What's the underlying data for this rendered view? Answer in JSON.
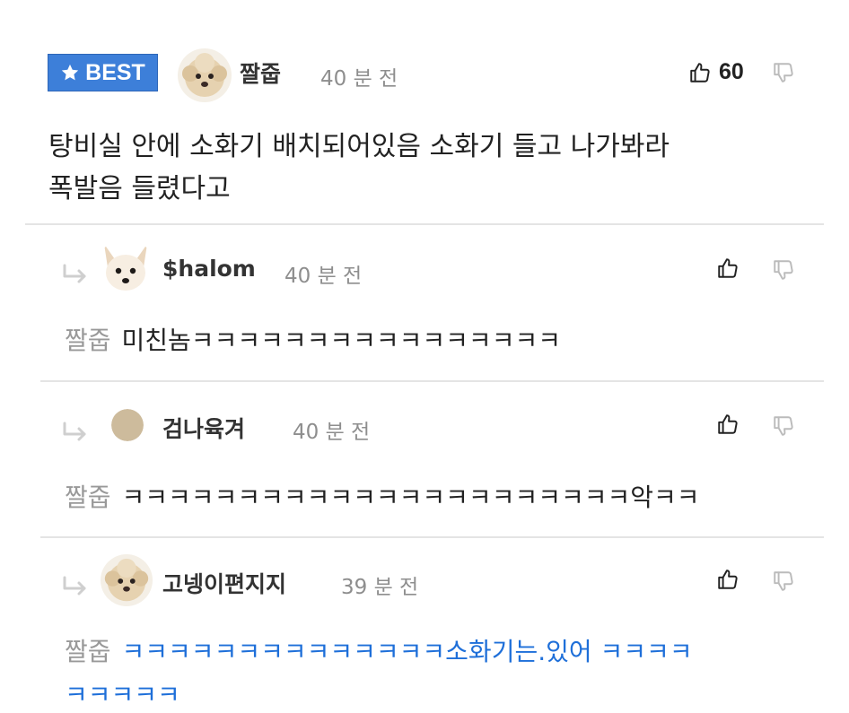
{
  "best": {
    "badge_label": "BEST",
    "author": "짤줍",
    "time": "40 분 전",
    "likes": "60",
    "text_line1": "탕비실 안에 소화기 배치되어있음 소화기 들고 나가봐라",
    "text_line2": "폭발음 들렸다고"
  },
  "replies": [
    {
      "author": "$halom",
      "time": "40 분 전",
      "mention": "짤줍",
      "text": "미친놈ㅋㅋㅋㅋㅋㅋㅋㅋㅋㅋㅋㅋㅋㅋㅋㅋ"
    },
    {
      "author": "검나육겨",
      "time": "40 분 전",
      "mention": "짤줍",
      "text": "ㅋㅋㅋㅋㅋㅋㅋㅋㅋㅋㅋㅋㅋㅋㅋㅋㅋㅋㅋㅋㅋㅋ악ㅋㅋ"
    },
    {
      "author": "고넹이편지지",
      "time": "39 분 전",
      "mention": "짤줍",
      "text_line1": "ㅋㅋㅋㅋㅋㅋㅋㅋㅋㅋㅋㅋㅋㅋ소화기는.있어 ㅋㅋㅋㅋ",
      "text_line2": "ㅋㅋㅋㅋㅋ"
    }
  ],
  "colors": {
    "badge": "#3d7fd9",
    "link": "#1e6fd9",
    "muted": "#8e8e8e"
  },
  "icons": {
    "badge": "star-icon",
    "like": "thumbs-up-icon",
    "dislike": "thumbs-down-icon",
    "reply": "reply-arrow-icon"
  }
}
